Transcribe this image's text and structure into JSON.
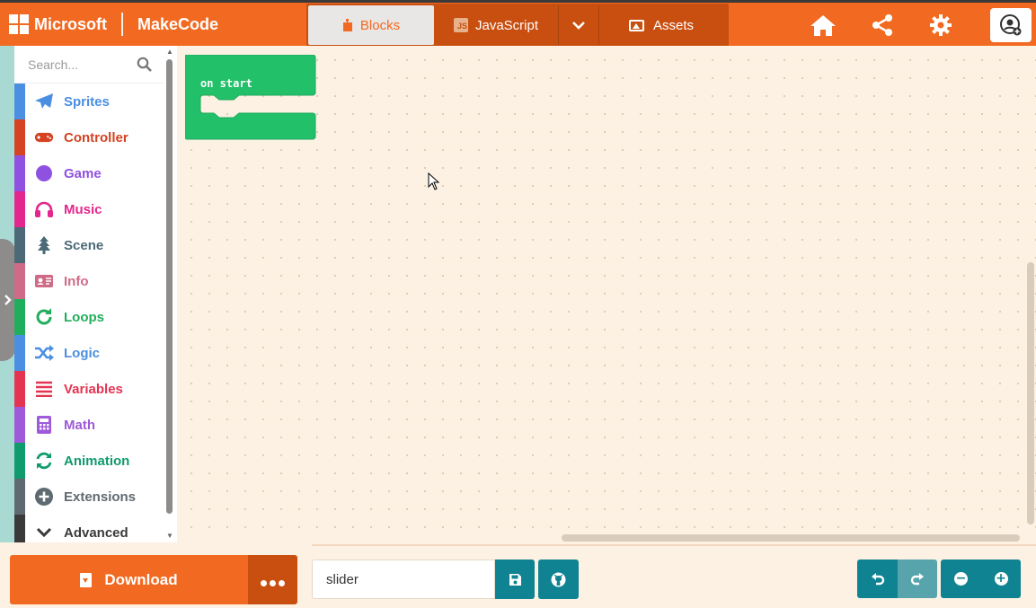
{
  "header": {
    "brand_microsoft": "Microsoft",
    "brand_makecode": "MakeCode",
    "tabs": [
      {
        "label": "Blocks",
        "icon": "puzzle-icon",
        "active": true
      },
      {
        "label": "JavaScript",
        "icon": "js-icon",
        "active": false
      },
      {
        "label": "",
        "icon": "chevron-down-icon",
        "active": false
      },
      {
        "label": "Assets",
        "icon": "image-icon",
        "active": false
      }
    ],
    "buttons": {
      "home": "home-icon",
      "share": "share-icon",
      "settings": "gear-icon",
      "profile": "profile-icon"
    },
    "colors": {
      "bar": "#f26a21",
      "tabs_bg": "#c94f10",
      "active_tab": "#e9e6e6"
    }
  },
  "toolbox": {
    "search_placeholder": "Search...",
    "categories": [
      {
        "label": "Sprites",
        "color": "#4b8fe2",
        "icon": "paper-plane-icon"
      },
      {
        "label": "Controller",
        "color": "#d54322",
        "icon": "gamepad-icon"
      },
      {
        "label": "Game",
        "color": "#8f52e0",
        "icon": "circle-icon"
      },
      {
        "label": "Music",
        "color": "#e4278e",
        "icon": "headphones-icon"
      },
      {
        "label": "Scene",
        "color": "#4b6976",
        "icon": "tree-icon"
      },
      {
        "label": "Info",
        "color": "#cf6a87",
        "icon": "id-card-icon"
      },
      {
        "label": "Loops",
        "color": "#21ae5c",
        "icon": "loop-icon"
      },
      {
        "label": "Logic",
        "color": "#4b8fe2",
        "icon": "shuffle-icon"
      },
      {
        "label": "Variables",
        "color": "#e53452",
        "icon": "list-icon"
      },
      {
        "label": "Math",
        "color": "#9e5ad8",
        "icon": "calculator-icon"
      },
      {
        "label": "Animation",
        "color": "#109b6e",
        "icon": "refresh-icon"
      },
      {
        "label": "Extensions",
        "color": "#5f6a70",
        "icon": "plus-circle-icon"
      },
      {
        "label": "Advanced",
        "color": "#3a3a3a",
        "icon": "chevron-down-icon"
      }
    ]
  },
  "workspace": {
    "block": {
      "label": "on start",
      "color": "#23c06a"
    }
  },
  "footer": {
    "download_label": "Download",
    "project_name": "slider",
    "accent": "#0f8392"
  }
}
